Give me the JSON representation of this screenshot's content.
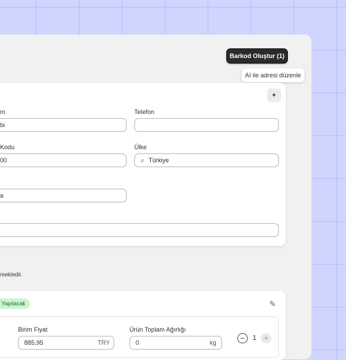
{
  "toolbar": {
    "barcode_button": "Barkod Oluştur (1)"
  },
  "tooltip": {
    "ai_edit": "AI ile adresi düzenle"
  },
  "icons": {
    "ai": "sparkle-icon",
    "search": "search-icon",
    "edit": "pencil-icon"
  },
  "address_form": {
    "name_label": "m",
    "name_value": "bi",
    "phone_label": "Telefon",
    "phone_value": "",
    "postal_label": "Kodu",
    "postal_value": "00",
    "country_label": "Ülke",
    "country_value": "Türkiye",
    "city_value": "a",
    "address_value": ""
  },
  "note": "mektedir.",
  "item": {
    "status_badge": "Yapılacak",
    "unit_price_label": "Birim Fiyat",
    "unit_price_value": "885,95",
    "currency": "TRY",
    "weight_label": "Ürün Toplam Ağırlığı",
    "weight_value": "0",
    "weight_unit": "kg",
    "quantity": "1",
    "minus": "−",
    "plus": "+"
  },
  "colors": {
    "background": "#cfd5ff",
    "badge_bg": "#c9f5d1",
    "button_dark": "#2b2b2b"
  }
}
